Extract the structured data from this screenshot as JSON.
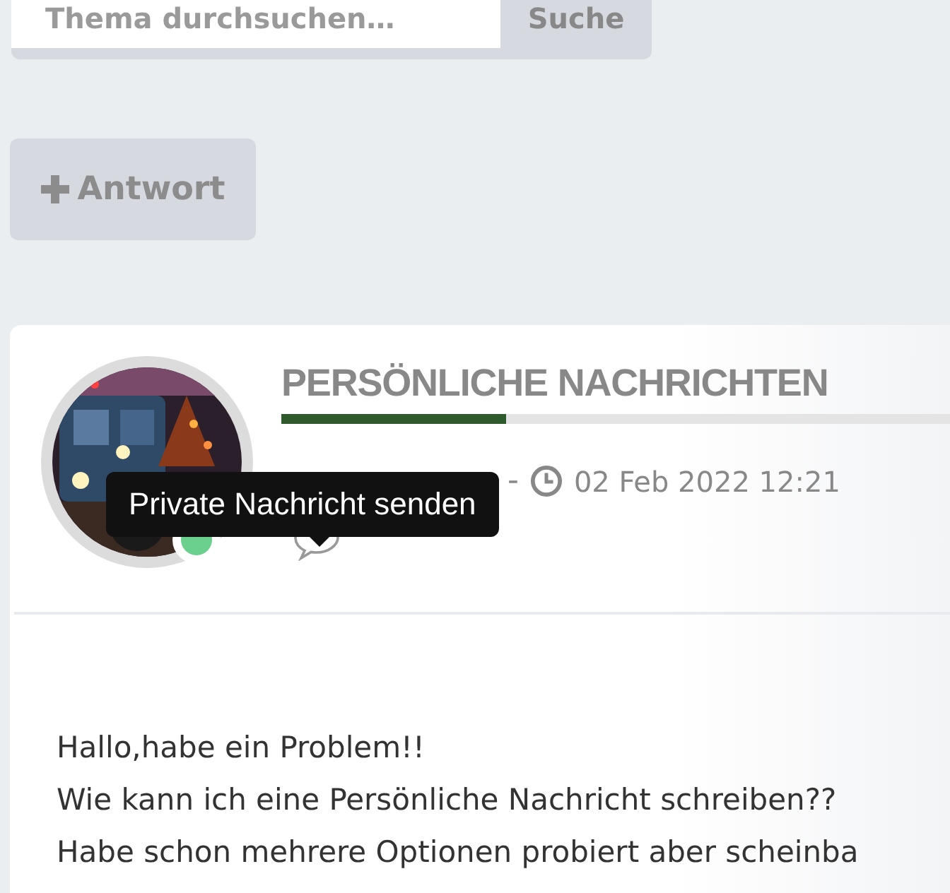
{
  "search": {
    "placeholder": "Thema durchsuchen…",
    "button": "Suche"
  },
  "reply_button": {
    "label": "Antwort"
  },
  "post": {
    "title": "PERSÖNLICHE NACHRICHTEN",
    "author_online": true,
    "separator": "-",
    "date": "02 Feb 2022 12:21",
    "tooltip": "Private Nachricht senden",
    "body": [
      "Hallo,habe ein Problem!!",
      "Wie kann ich eine Persönliche Nachricht schreiben??",
      "Habe schon mehrere Optionen probiert aber scheinba"
    ]
  }
}
